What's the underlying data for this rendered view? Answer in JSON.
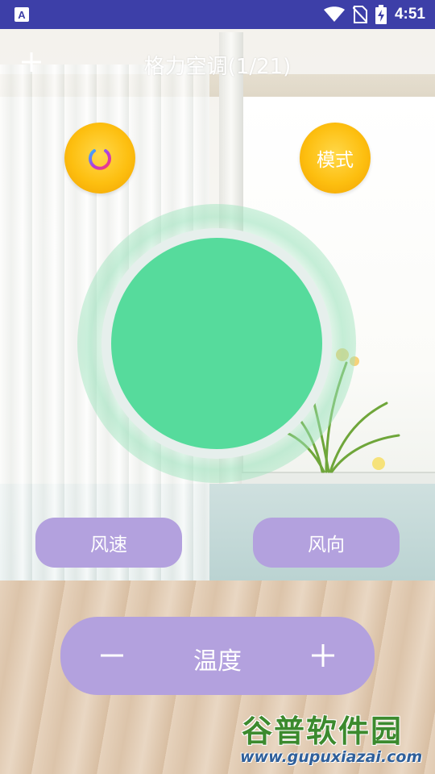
{
  "status_bar": {
    "time": "4:51",
    "icons": [
      "app-notification-icon",
      "wifi-icon",
      "no-sim-icon",
      "battery-charging-icon"
    ]
  },
  "title_bar": {
    "title": "格力空调(1/21)",
    "add_icon": "plus-icon"
  },
  "controls": {
    "power_icon": "power-icon",
    "mode_label": "模式",
    "fan_speed_label": "风速",
    "fan_direction_label": "风向",
    "temperature_label": "温度",
    "temp_minus_icon": "minus-icon",
    "temp_plus_icon": "plus-icon"
  },
  "watermark": {
    "name": "谷普软件园",
    "url": "www.gupuxiazai.com"
  },
  "colors": {
    "status_bar": "#3d3fa8",
    "accent_yellow": "#fdbf10",
    "dial_green": "#56db9c",
    "pill_purple": "#b3a1de"
  }
}
